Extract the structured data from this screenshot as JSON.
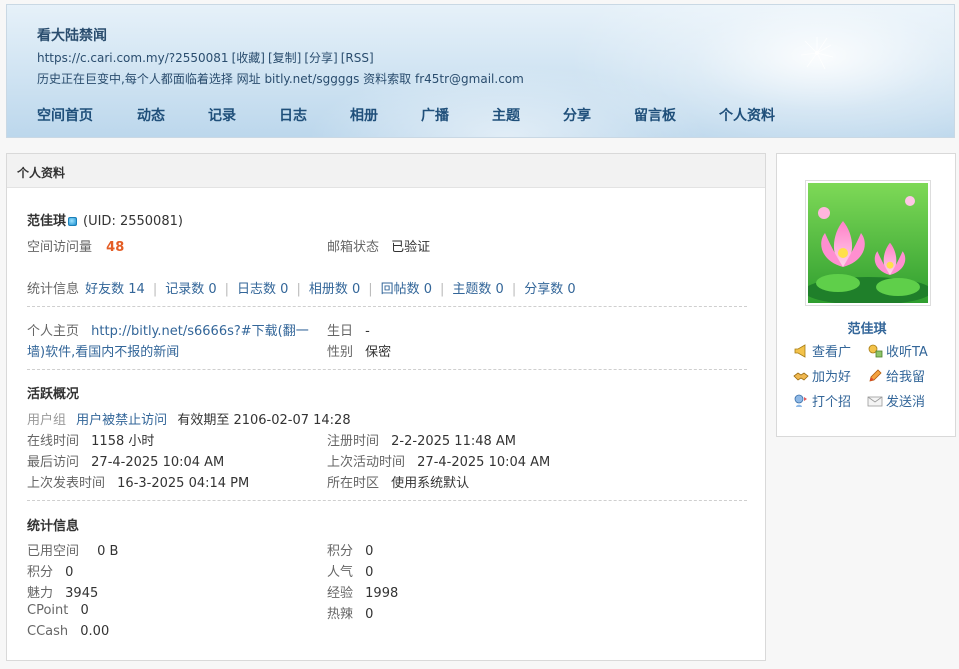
{
  "header": {
    "title": "看大陆禁闻",
    "url": "https://c.cari.com.my/?2550081",
    "url_actions": [
      "[收藏]",
      "[复制]",
      "[分享]",
      "[RSS]"
    ],
    "description": "历史正在巨变中,每个人都面临着选择 网址 bitly.net/sggggs 资料索取 fr45tr@gmail.com",
    "nav": [
      "空间首页",
      "动态",
      "记录",
      "日志",
      "相册",
      "广播",
      "主题",
      "分享",
      "留言板",
      "个人资料"
    ]
  },
  "panel": {
    "title": "个人资料",
    "user_name": "范佳琪",
    "uid": "(UID: 2550081)",
    "visits_label": "空间访问量",
    "visits_value": "48",
    "email_label": "邮箱状态",
    "email_value": "已验证",
    "stats_label": "统计信息",
    "stats": [
      "好友数 14",
      "记录数 0",
      "日志数 0",
      "相册数 0",
      "回帖数 0",
      "主题数 0",
      "分享数 0"
    ],
    "homepage_label": "个人主页",
    "homepage_line1": "http://bitly.net/s6666s?#下载(翻一",
    "homepage_line2": "墙)软件,看国内不报的新闻",
    "birthday_label": "生日",
    "birthday_value": "-",
    "gender_label": "性别",
    "gender_value": "保密",
    "activity_title": "活跃概况",
    "usergroup_label": "用户组",
    "usergroup_value": "用户被禁止访问",
    "usergroup_expiry": "有效期至 2106-02-07 14:28",
    "online_label": "在线时间",
    "online_value": "1158 小时",
    "register_label": "注册时间",
    "register_value": "2-2-2025 11:48 AM",
    "lastvisit_label": "最后访问",
    "lastvisit_value": "27-4-2025 10:04 AM",
    "lastactive_label": "上次活动时间",
    "lastactive_value": "27-4-2025 10:04 AM",
    "lastpost_label": "上次发表时间",
    "lastpost_value": "16-3-2025 04:14 PM",
    "timezone_label": "所在时区",
    "timezone_value": "使用系统默认",
    "stats_title": "统计信息",
    "space_label": "已用空间",
    "space_value": "0 B",
    "points_r_label": "积分",
    "points_r_value": "0",
    "points_l_label": "积分",
    "points_l_value": "0",
    "pop_label": "人气",
    "pop_value": "0",
    "charm_label": "魅力",
    "charm_value": "3945",
    "exp_label": "经验",
    "exp_value": "1998",
    "cpoint_label": "CPoint",
    "cpoint_value": "0",
    "hot_label": "热辣",
    "hot_value": "0",
    "ccash_label": "CCash",
    "ccash_value": "0.00"
  },
  "sidebar": {
    "name": "范佳琪",
    "actions": [
      "查看广",
      "收听TA",
      "加为好",
      "给我留",
      "打个招",
      "发送消"
    ]
  }
}
